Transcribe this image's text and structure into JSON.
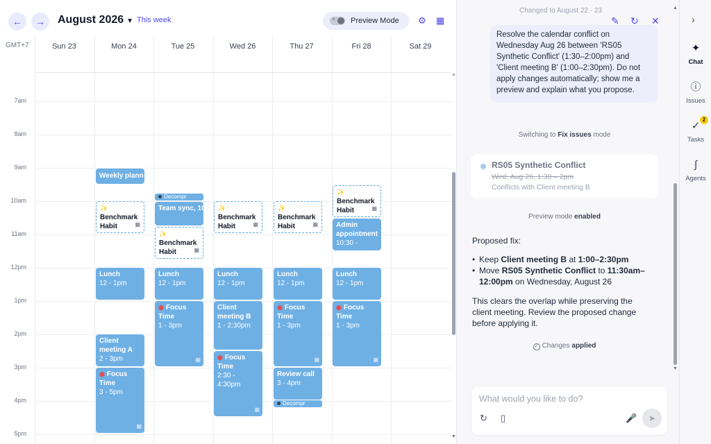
{
  "calendar": {
    "month": "August 2026",
    "this_week": "This week",
    "preview_mode": "Preview Mode",
    "timezone": "GMT+7",
    "days": [
      "Sun 23",
      "Mon 24",
      "Tue 25",
      "Wed 26",
      "Thu 27",
      "Fri 28",
      "Sat 29"
    ],
    "times": [
      "7am",
      "8am",
      "9am",
      "10am",
      "11am",
      "12pm",
      "1pm",
      "2pm",
      "3pm",
      "4pm",
      "5pm"
    ],
    "events": {
      "weekly_planning": "Weekly plann",
      "decompr": "Decompr",
      "team_sync": "Team sync, 10",
      "benchmark": "Benchmark",
      "habit": "Habit",
      "admin_title": "Admin appointment",
      "admin_time": "10:30 -",
      "lunch": "Lunch",
      "lunch_time": "12 - 1pm",
      "focus": "Focus",
      "time_word": "Time",
      "focus_1_3": "1 - 3pm",
      "focus_3_5": "3 - 5pm",
      "focus_230": "2:30 -",
      "focus_430": "4:30pm",
      "client_b_title": "Client meeting B",
      "client_b_time": "1 - 2:30pm",
      "client_a_title": "Client meeting A",
      "client_a_time": "2 - 3pm",
      "review_call": "Review call",
      "review_time": "3 - 4pm"
    }
  },
  "chat": {
    "changed_by": "Changed to August 22 - 23",
    "user_message": "Resolve the calendar conflict on Wednesday Aug 26 between 'RS05 Synthetic Conflict' (1:30–2:00pm) and 'Client meeting B' (1:00–2:30pm). Do not apply changes automatically; show me a preview and explain what you propose.",
    "switching_prefix": "Switching to ",
    "switching_mode": "Fix issues",
    "switching_suffix": " mode",
    "issue_title": "RS05 Synthetic Conflict",
    "issue_date": "Wed, Aug 26, 1:30 – 2pm",
    "issue_conflict": "Conflicts with Client meeting B",
    "preview_prefix": "Preview mode ",
    "preview_state": "enabled",
    "proposed_label": "Proposed fix:",
    "b1_a": "Keep ",
    "b1_b": "Client meeting B",
    "b1_c": " at ",
    "b1_d": "1:00–2:30pm",
    "b2_a": "Move ",
    "b2_b": "RS05 Synthetic Conflict",
    "b2_c": " to ",
    "b2_d": "11:30am–12:00pm",
    "b2_e": " on Wednesday, August 26",
    "explanation": "This clears the overlap while preserving the client meeting. Review the proposed change before applying it.",
    "changes_prefix": "Changes ",
    "changes_state": "applied",
    "composer_placeholder": "What would you like to do?"
  },
  "rail": {
    "chat": "Chat",
    "issues": "Issues",
    "tasks": "Tasks",
    "tasks_badge": "2",
    "agents": "Agents"
  },
  "colors": {
    "accent": "#4f46e5",
    "event_blue": "#6fb0e4",
    "focus_icon": "#ef4444",
    "badge": "#facc15"
  }
}
